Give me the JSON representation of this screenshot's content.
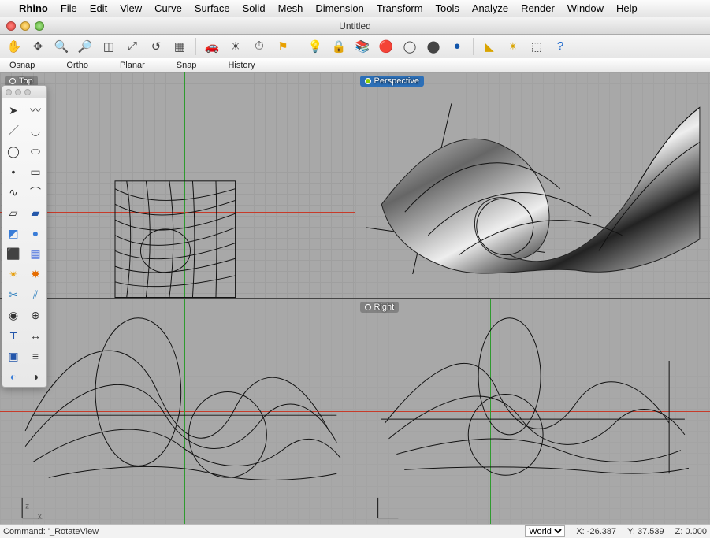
{
  "menubar": {
    "appname": "Rhino",
    "items": [
      "File",
      "Edit",
      "View",
      "Curve",
      "Surface",
      "Solid",
      "Mesh",
      "Dimension",
      "Transform",
      "Tools",
      "Analyze",
      "Render",
      "Window",
      "Help"
    ]
  },
  "window": {
    "title": "Untitled"
  },
  "toolbar_icons": [
    "pan-icon",
    "rotate-view-icon",
    "zoom-in-icon",
    "zoom-out-icon",
    "zoom-window-icon",
    "zoom-extents-icon",
    "undo-view-icon",
    "grid-icon",
    "car-icon",
    "sun-icon",
    "clock-icon",
    "flag-icon",
    "bulb-icon",
    "lock-icon",
    "layers-icon",
    "material-icon",
    "sphere-wire-icon",
    "sphere-shaded-icon",
    "sphere-render-icon",
    "arrow-icon",
    "plugin-icon",
    "transform-icon",
    "help-icon"
  ],
  "snapbar": [
    "Osnap",
    "Ortho",
    "Planar",
    "Snap",
    "History"
  ],
  "viewports": {
    "top": "Top",
    "persp": "Perspective",
    "front": "",
    "right": "Right"
  },
  "palette_tools": [
    "pointer",
    "lasso",
    "polyline",
    "arc",
    "circle",
    "ellipse",
    "point",
    "rectangle",
    "curve",
    "fillet",
    "surface-pt",
    "surface-loft",
    "box",
    "sphere-tool",
    "cylinder",
    "mesh-tool",
    "puzzle",
    "explode",
    "trim",
    "split",
    "booleans",
    "group",
    "text",
    "dim",
    "array",
    "align",
    "render-mesh",
    "material-tool"
  ],
  "statusbar": {
    "command_label": "Command:",
    "command_value": "'_RotateView",
    "cplane": "World",
    "x_label": "X:",
    "x_val": "-26.387",
    "y_label": "Y:",
    "y_val": "37.539",
    "z_label": "Z:",
    "z_val": "0.000"
  },
  "colors": {
    "axis_x": "#c73b2a",
    "axis_y": "#2f9a2f",
    "active_tab": "#2c6fb7"
  }
}
